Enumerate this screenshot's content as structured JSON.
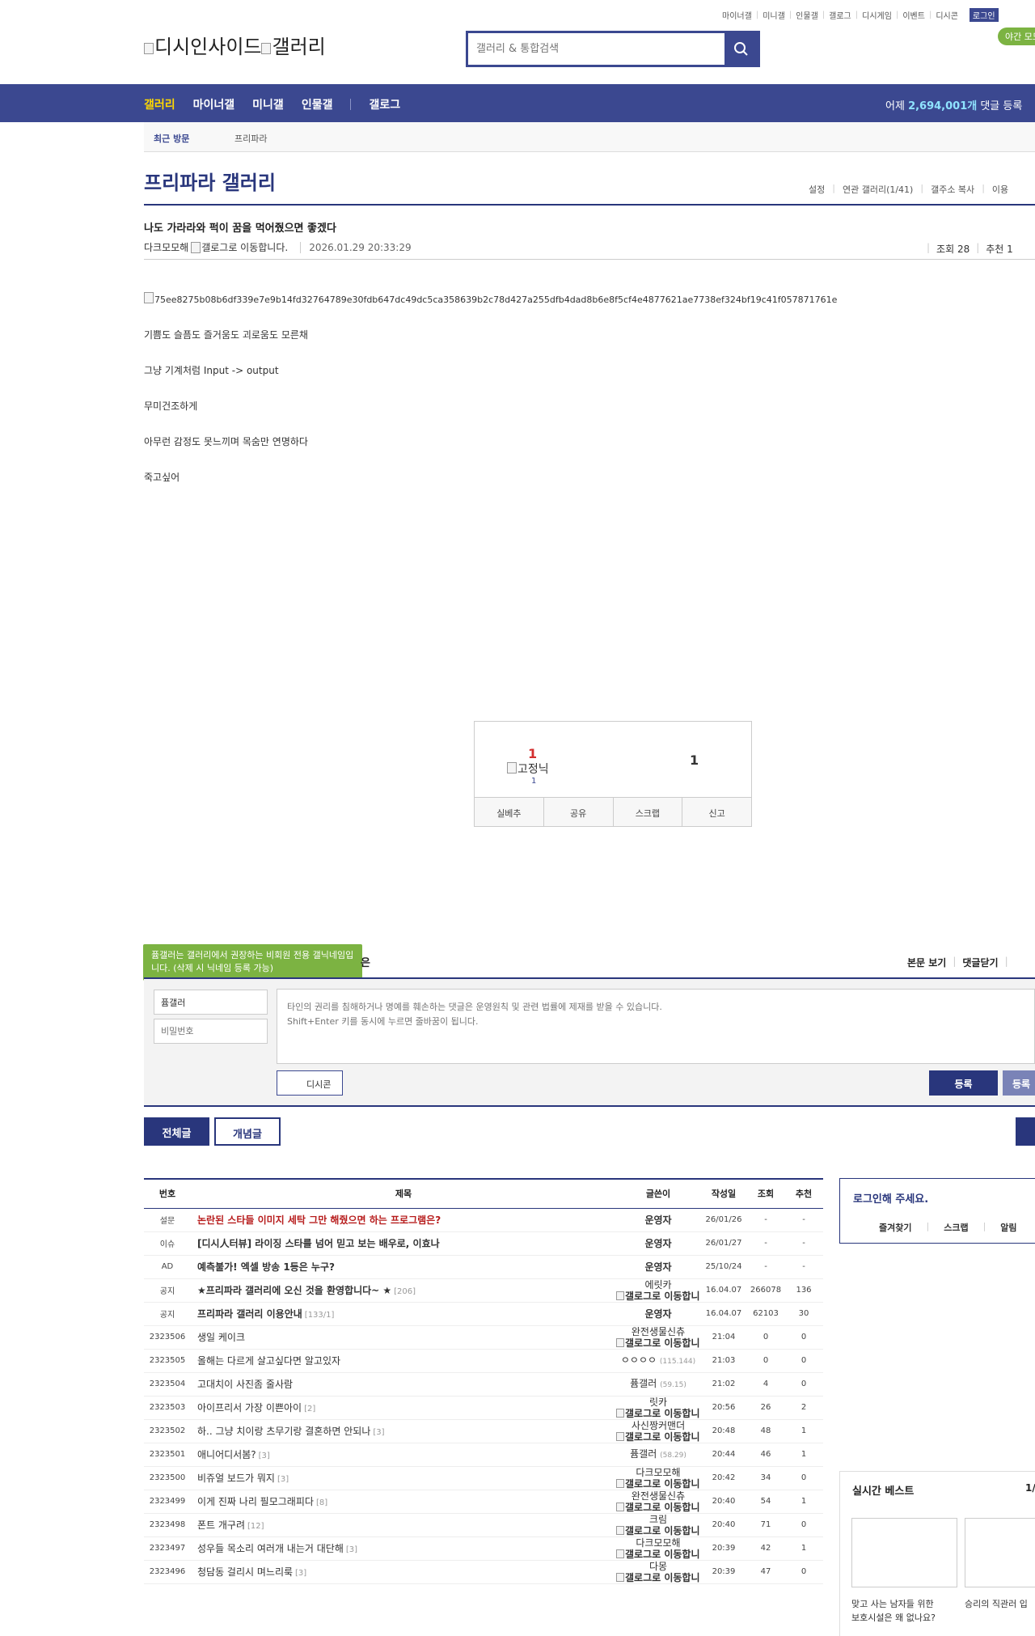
{
  "header": {
    "util_links": [
      "마이너갤",
      "미니갤",
      "인물갤",
      "갤로그",
      "디시게임",
      "이벤트",
      "디시콘"
    ],
    "login_label": "로그인",
    "night_mode": "야간 모드",
    "logo_text_1": "디시인사이드",
    "logo_text_2": "갤러리",
    "search_placeholder": "갤러리 & 통합검색"
  },
  "nav": {
    "items": [
      "갤러리",
      "마이너갤",
      "미니갤",
      "인물갤",
      "갤로그"
    ],
    "yesterday_prefix": "어제 ",
    "yesterday_count": "2,694,001개",
    "yesterday_suffix": " 댓글 등록"
  },
  "recent": {
    "label": "최근 방문",
    "item": "프리파라"
  },
  "gallery": {
    "title": "프리파라 갤러리",
    "links": [
      "설정",
      "연관 갤러리(1/41)",
      "갤주소 복사",
      "이용"
    ]
  },
  "post": {
    "title": "나도 가라라와 퍽이 꿈을 먹어줬으면 좋겠다",
    "author": "다크모모해",
    "gallog_alt": "갤로그로 이동합니다.",
    "date": "2026.01.29 20:33:29",
    "views": "조회 28",
    "recommend": "추천 1",
    "image_alt": "75ee8275b08b6df339e7e9b14fd32764789e30fdb647dc49dc5ca358639b2c78d427a255dfb4dad8b6e8f5cf4e4877621ae7738ef324bf19c41f057871761e",
    "lines": [
      "기쁨도 슬픔도 즐거움도 괴로움도 모른채",
      "그냥 기계처럼 Input -> output",
      "무미건조하게",
      "아무런 감정도 못느끼며 목숨만 연명하다",
      "죽고싶어"
    ]
  },
  "recommend_box": {
    "up_count": "1",
    "fixed_nick": "고정닉",
    "fixed_count": "1",
    "down_count": "1",
    "buttons": [
      "실베추",
      "공유",
      "스크랩",
      "신고"
    ]
  },
  "comment": {
    "tooltip": "퓸갤러는 갤러리에서 권장하는 비회원 전용 갤닉네임입니다. (삭제 시 닉네임 등록 가능)",
    "title_tail": "은",
    "links": [
      "본문 보기",
      "댓글닫기"
    ],
    "nick_value": "퓸갤러",
    "pw_placeholder": "비밀번호",
    "textarea_placeholder": "타인의 권리를 침해하거나 명예를 훼손하는 댓글은 운영원칙 및 관련 법률에 제재를 받을 수 있습니다.\nShift+Enter 키를 동시에 누르면 줄바꿈이 됩니다.",
    "dccon_label": "디시콘",
    "submit_label": "등록",
    "submit2_label": "등록"
  },
  "list_tabs": {
    "all": "전체글",
    "best": "개념글"
  },
  "list": {
    "headers": [
      "번호",
      "제목",
      "글쓴이",
      "작성일",
      "조회",
      "추천"
    ],
    "rows": [
      {
        "num": "설문",
        "title": "논란된 스타들 이미지 세탁 그만 해줬으면 하는 프로그램은?",
        "rc": "",
        "nick": "운영자",
        "nick2": "",
        "ip": "",
        "date": "26/01/26",
        "view": "-",
        "rec": "-",
        "kind": "hot"
      },
      {
        "num": "이슈",
        "title": "[디시人터뷰] 라이징 스타를 넘어 믿고 보는 배우로, 이효나",
        "rc": "",
        "nick": "운영자",
        "nick2": "",
        "ip": "",
        "date": "26/01/27",
        "view": "-",
        "rec": "-",
        "kind": "notice"
      },
      {
        "num": "AD",
        "title": "예측불가! 엑셀 방송 1등은 누구?",
        "rc": "",
        "nick": "운영자",
        "nick2": "",
        "ip": "",
        "date": "25/10/24",
        "view": "-",
        "rec": "-",
        "kind": "notice"
      },
      {
        "num": "공지",
        "title": "★프리파라 갤러리에 오신 것을 환영합니다~ ★",
        "rc": "[206]",
        "nick": "에릿카",
        "nick2": "갤로그로 이동합니다.",
        "ip": "",
        "date": "16.04.07",
        "view": "266078",
        "rec": "136",
        "kind": "notice"
      },
      {
        "num": "공지",
        "title": "프리파라 갤러리 이용안내",
        "rc": "[133/1]",
        "nick": "운영자",
        "nick2": "",
        "ip": "",
        "date": "16.04.07",
        "view": "62103",
        "rec": "30",
        "kind": "notice"
      },
      {
        "num": "2323506",
        "title": "생일 케이크",
        "rc": "",
        "nick": "완전생물신츄",
        "nick2": "갤로그로 이동합니다.",
        "ip": "",
        "date": "21:04",
        "view": "0",
        "rec": "0",
        "kind": ""
      },
      {
        "num": "2323505",
        "title": "올해는 다르게 살고싶다면 알고있자",
        "rc": "",
        "nick": "ㅇㅇㅇㅇ",
        "nick2": "",
        "ip": "(115.144)",
        "date": "21:03",
        "view": "0",
        "rec": "0",
        "kind": ""
      },
      {
        "num": "2323504",
        "title": "고대치이 사진좀 줄사람",
        "rc": "",
        "nick": "퓸갤러",
        "nick2": "",
        "ip": "(59.15)",
        "date": "21:02",
        "view": "4",
        "rec": "0",
        "kind": ""
      },
      {
        "num": "2323503",
        "title": "아이프리서 가장 이쁜아이",
        "rc": "[2]",
        "nick": "릿카",
        "nick2": "갤로그로 이동합니다.",
        "ip": "",
        "date": "20:56",
        "view": "26",
        "rec": "2",
        "kind": ""
      },
      {
        "num": "2323502",
        "title": "하.. 그냥 치이랑 츠무기랑 결혼하면 안되나",
        "rc": "[3]",
        "nick": "사신짱커맨더",
        "nick2": "갤로그로 이동합니다.",
        "ip": "",
        "date": "20:48",
        "view": "48",
        "rec": "1",
        "kind": ""
      },
      {
        "num": "2323501",
        "title": "애니어디서봄?",
        "rc": "[3]",
        "nick": "퓸갤러",
        "nick2": "",
        "ip": "(58.29)",
        "date": "20:44",
        "view": "46",
        "rec": "1",
        "kind": ""
      },
      {
        "num": "2323500",
        "title": "비쥬얼 보드가 뭐지",
        "rc": "[3]",
        "nick": "다크모모해",
        "nick2": "갤로그로 이동합니다.",
        "ip": "",
        "date": "20:42",
        "view": "34",
        "rec": "0",
        "kind": ""
      },
      {
        "num": "2323499",
        "title": "이게 진짜 나리 필모그래피다",
        "rc": "[8]",
        "nick": "완전생물신츄",
        "nick2": "갤로그로 이동합니다.",
        "ip": "",
        "date": "20:40",
        "view": "54",
        "rec": "1",
        "kind": ""
      },
      {
        "num": "2323498",
        "title": "폰트 개구려",
        "rc": "[12]",
        "nick": "크림",
        "nick2": "갤로그로 이동합니다.",
        "ip": "",
        "date": "20:40",
        "view": "71",
        "rec": "0",
        "kind": ""
      },
      {
        "num": "2323497",
        "title": "성우들 목소리 여러개 내는거 대단해",
        "rc": "[3]",
        "nick": "다크모모해",
        "nick2": "갤로그로 이동합니다.",
        "ip": "",
        "date": "20:39",
        "view": "42",
        "rec": "1",
        "kind": ""
      },
      {
        "num": "2323496",
        "title": "청담동 걸리시 며느리룩",
        "rc": "[3]",
        "nick": "다몽",
        "nick2": "갤로그로 이동합니다.",
        "ip": "",
        "date": "20:39",
        "view": "47",
        "rec": "0",
        "kind": ""
      }
    ]
  },
  "sidebar": {
    "login_title": "로그인해 주세요.",
    "login_links": [
      "즐겨찾기",
      "스크랩",
      "알림"
    ],
    "best_title": "실시간 베스트",
    "best_page": "1/",
    "best_items": [
      "맞고 사는 남자들 위한\n보호시설은 왜 없나요?",
      "승리의 직관러 입"
    ]
  }
}
